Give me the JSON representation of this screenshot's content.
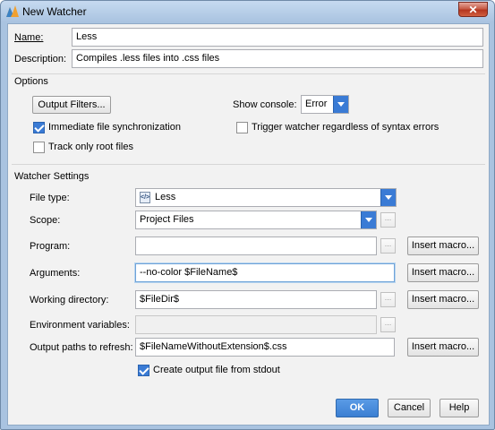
{
  "window": {
    "title": "New Watcher",
    "close_glyph": "✕",
    "app_icon": "intellij-icon"
  },
  "name": {
    "label": "Name:",
    "value": "Less"
  },
  "description": {
    "label": "Description:",
    "value": "Compiles .less files into .css files"
  },
  "options": {
    "heading": "Options",
    "output_filters_btn": "Output Filters...",
    "show_console_label": "Show console:",
    "show_console_value": "Error",
    "immediate_sync": {
      "label": "Immediate file synchronization",
      "checked": true
    },
    "trigger_watcher": {
      "label": "Trigger watcher regardless of syntax errors",
      "checked": false
    },
    "track_root": {
      "label": "Track only root files",
      "checked": false
    }
  },
  "watcher": {
    "heading": "Watcher Settings",
    "file_type": {
      "label": "File type:",
      "value": "Less",
      "icon": "less-file-icon"
    },
    "scope": {
      "label": "Scope:",
      "value": "Project Files",
      "ellipsis": "..."
    },
    "program": {
      "label": "Program:",
      "value": "",
      "ellipsis": "...",
      "insert_macro": "Insert macro..."
    },
    "arguments": {
      "label": "Arguments:",
      "value": "--no-color $FileName$",
      "insert_macro": "Insert macro..."
    },
    "working_dir": {
      "label": "Working directory:",
      "value": "$FileDir$",
      "ellipsis": "...",
      "insert_macro": "Insert macro..."
    },
    "env_vars": {
      "label": "Environment variables:",
      "value": "",
      "ellipsis": "..."
    },
    "output_paths": {
      "label": "Output paths to refresh:",
      "value": "$FileNameWithoutExtension$.css",
      "insert_macro": "Insert macro..."
    },
    "create_output": {
      "label": "Create output file from stdout",
      "checked": true
    }
  },
  "footer": {
    "ok": "OK",
    "cancel": "Cancel",
    "help": "Help"
  }
}
